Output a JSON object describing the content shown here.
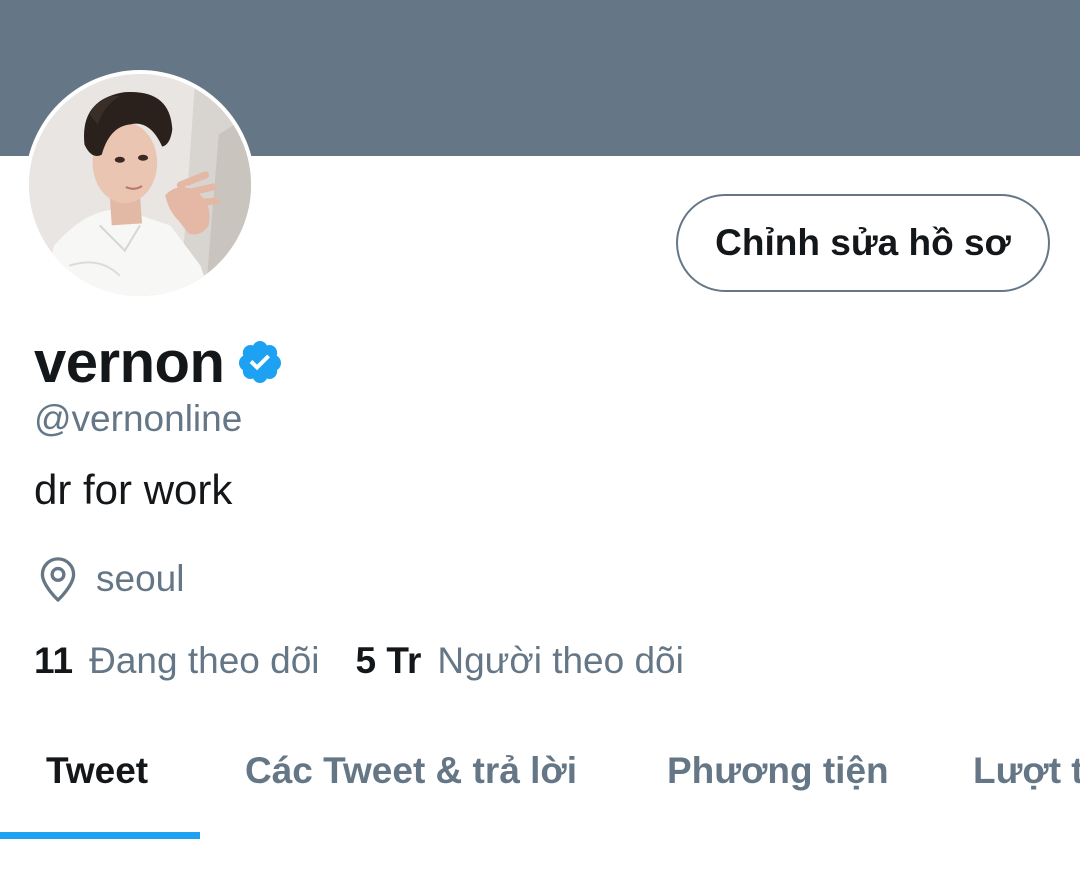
{
  "profile": {
    "display_name": "vernon",
    "handle": "@vernonline",
    "bio": "dr for work",
    "location": "seoul",
    "verified": true
  },
  "actions": {
    "edit_profile_label": "Chỉnh sửa hồ sơ"
  },
  "stats": {
    "following_count": "11",
    "following_label": "Đang theo dõi",
    "followers_count": "5 Tr",
    "followers_label": "Người theo dõi"
  },
  "tabs": [
    {
      "label": "Tweet",
      "active": true
    },
    {
      "label": "Các Tweet & trả lời",
      "active": false
    },
    {
      "label": "Phương tiện",
      "active": false
    },
    {
      "label": "Lượt thích",
      "active": false
    }
  ],
  "colors": {
    "banner": "#657786",
    "accent": "#1da1f2",
    "primary_text": "#14171a",
    "secondary_text": "#657786"
  },
  "icons": {
    "verified": "verified-badge-icon",
    "location": "location-pin-icon"
  }
}
